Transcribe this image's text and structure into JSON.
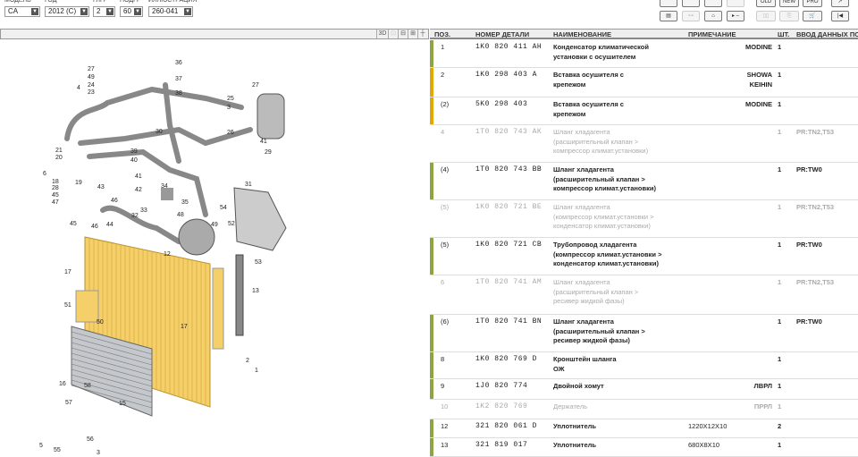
{
  "selectors": [
    {
      "label": "МОДЕЛЬ",
      "value": "CA"
    },
    {
      "label": "ГОД",
      "value": "2012 (C)"
    },
    {
      "label": "ГЛГР",
      "value": "2"
    },
    {
      "label": "ПОДГР",
      "value": "60"
    },
    {
      "label": "ИЛЛЮСТРАЦИЯ",
      "value": "260-041"
    }
  ],
  "toolbar": {
    "old": "OLD",
    "new": "NEW",
    "pro": "PRO"
  },
  "view_buttons": {
    "three_d": "3D"
  },
  "table": {
    "headers": {
      "pos": "ПОЗ.",
      "part": "НОМЕР ДЕТАЛИ",
      "name": "НАИМЕНОВАНИЕ",
      "note": "ПРИМЕЧАНИЕ",
      "qty": "ШТ.",
      "input": "ВВОД ДАННЫХ ПО"
    },
    "rows": [
      {
        "pos": "1",
        "part": "1K0 820 411 AH",
        "name": "Конденсатор климатической\nустановки с осушителем",
        "note": "MODINE",
        "qty": "1",
        "input": "",
        "state": "green"
      },
      {
        "pos": "2",
        "part": "1K0 298 403 A",
        "name": "Вставка осушителя с\nкрепежом",
        "note": "SHOWA\nKEIHIN",
        "qty": "1",
        "input": "",
        "state": "yellow"
      },
      {
        "pos": "(2)",
        "part": "5K0 298 403",
        "name": "Вставка осушителя с\nкрепежом",
        "note": "MODINE",
        "qty": "1",
        "input": "",
        "state": "yellow"
      },
      {
        "pos": "4",
        "part": "1T0 820 743 AK",
        "name": "Шланг хладагента\n(расширительный клапан >\nкомпрессор климат.установки)",
        "note": "",
        "qty": "1",
        "input": "PR:TN2,T53",
        "state": "grey"
      },
      {
        "pos": "(4)",
        "part": "1T0 820 743 BB",
        "name": "Шланг хладагента\n(расширительный клапан >\nкомпрессор климат.установки)",
        "note": "",
        "qty": "1",
        "input": "PR:TW0",
        "state": "green"
      },
      {
        "pos": "(5)",
        "part": "1K0 820 721 BE",
        "name": "Шланг хладагента\n(компрессор климат.установки >\nконденсатор климат.установки)",
        "note": "",
        "qty": "1",
        "input": "PR:TN2,T53",
        "state": "grey"
      },
      {
        "pos": "(5)",
        "part": "1K0 820 721 CB",
        "name": "Трубопровод хладагента\n(компрессор климат.установки >\nконденсатор климат.установки)",
        "note": "",
        "qty": "1",
        "input": "PR:TW0",
        "state": "green"
      },
      {
        "pos": "6",
        "part": "1T0 820 741 AM",
        "name": "Шланг хладагента\n(расширительный клапан >\nресивер жидкой фазы)",
        "note": "",
        "qty": "1",
        "input": "PR:TN2,T53",
        "state": "grey"
      },
      {
        "pos": "(6)",
        "part": "1T0 820 741 BN",
        "name": "Шланг хладагента\n(расширительный клапан >\nресивер жидкой фазы)",
        "note": "",
        "qty": "1",
        "input": "PR:TW0",
        "state": "green"
      },
      {
        "pos": "8",
        "part": "1K0 820 769 D",
        "name": "Кронштейн шланга\nОЖ",
        "note": "",
        "qty": "1",
        "input": "",
        "state": "green"
      },
      {
        "pos": "9",
        "part": "1J0 820 774",
        "name": "Двойной хомут",
        "note": "ЛВРЛ",
        "qty": "1",
        "input": "",
        "state": "green"
      },
      {
        "pos": "10",
        "part": "1K2 820 769",
        "name": "Держатель",
        "note": "ПРРЛ",
        "qty": "1",
        "input": "",
        "state": "grey"
      },
      {
        "pos": "12",
        "part": "321 820 061 D",
        "name": "Уплотнитель",
        "note2": "1220X12X10",
        "note": "",
        "qty": "2",
        "input": "",
        "state": "green"
      },
      {
        "pos": "13",
        "part": "321 819 017",
        "name": "Уплотнитель",
        "note2": "680X8X10",
        "note": "",
        "qty": "1",
        "input": "",
        "state": "green"
      }
    ]
  },
  "colors": {
    "green": "#8ca542",
    "yellow": "#e2a800",
    "condenser": "#f4cf6a"
  },
  "diagram": {
    "callouts": [
      "36",
      "37",
      "38",
      "27",
      "49",
      "24",
      "23",
      "4",
      "25",
      "3",
      "27",
      "26",
      "41",
      "29",
      "30",
      "21",
      "20",
      "39",
      "40",
      "6",
      "18",
      "28",
      "45",
      "47",
      "43",
      "19",
      "41",
      "42",
      "34",
      "31",
      "44",
      "46",
      "33",
      "32",
      "35",
      "48",
      "49",
      "54",
      "52",
      "45",
      "46",
      "53",
      "12",
      "17",
      "13",
      "51",
      "50",
      "17",
      "2",
      "1",
      "16",
      "58",
      "57",
      "56",
      "15",
      "5",
      "55",
      "3"
    ]
  }
}
